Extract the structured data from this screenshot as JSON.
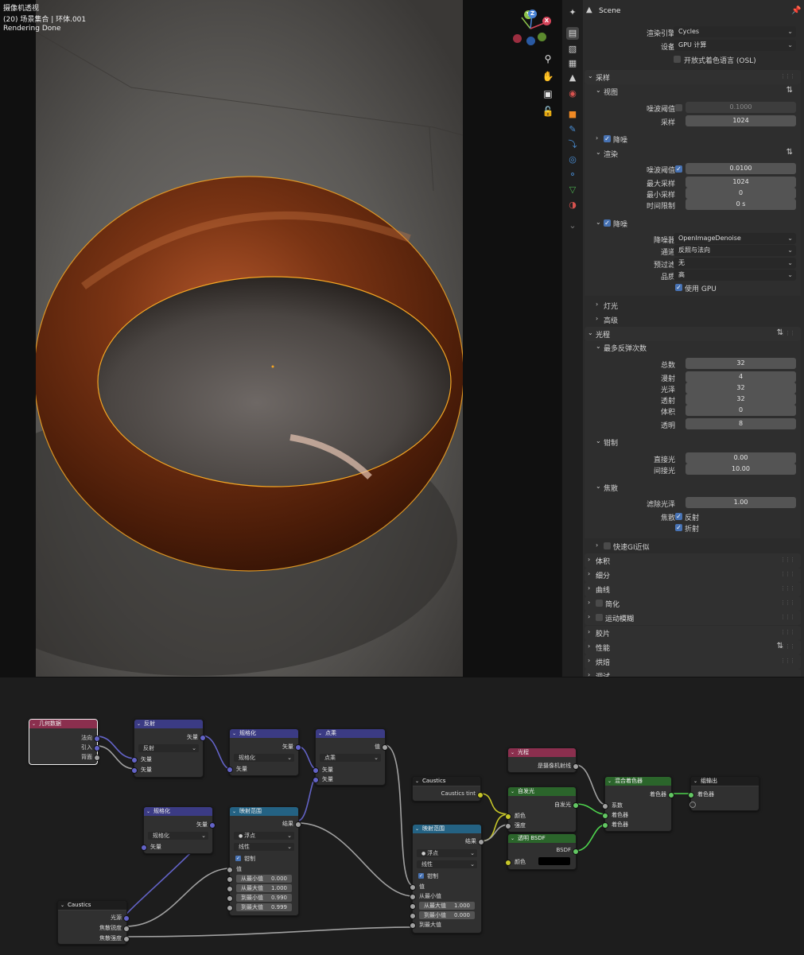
{
  "viewport": {
    "mode_label": "摄像机透视",
    "collection_label": "(20) 场景集合 | 环体.001",
    "status_label": "Rendering Done",
    "gizmo": {
      "y": "Y",
      "z": "Z",
      "x": "X"
    },
    "tools": {
      "zoom": "search-icon",
      "pan": "hand-icon",
      "camera": "camera-icon",
      "lock": "lock-icon"
    }
  },
  "props": {
    "header_title": "Scene",
    "render_engine_label": "渲染引擎",
    "render_engine_value": "Cycles",
    "device_label": "设备",
    "device_value": "GPU 计算",
    "osl_label": "开放式着色语言 (OSL)",
    "sampling": {
      "title": "采样",
      "viewport": {
        "title": "视图",
        "noise_threshold_label": "噪波阈值",
        "noise_threshold_value": "0.1000",
        "samples_label": "采样",
        "samples_value": "1024"
      },
      "viewport_denoise_title": "降噪",
      "render": {
        "title": "渲染",
        "noise_threshold_label": "噪波阈值",
        "noise_threshold_value": "0.0100",
        "max_samples_label": "最大采样",
        "max_samples_value": "1024",
        "min_samples_label": "最小采样",
        "min_samples_value": "0",
        "time_limit_label": "时间限制",
        "time_limit_value": "0 s"
      },
      "denoise": {
        "title": "降噪",
        "denoiser_label": "降噪器",
        "denoiser_value": "OpenImageDenoise",
        "passes_label": "通道",
        "passes_value": "反照与法向",
        "prefilter_label": "预过滤",
        "prefilter_value": "无",
        "quality_label": "品质",
        "quality_value": "高",
        "use_gpu_label": "使用 GPU"
      },
      "lights_title": "灯光",
      "advanced_title": "高级"
    },
    "light_paths": {
      "title": "光程",
      "max_bounces": {
        "title": "最多反弹次数",
        "rows": [
          {
            "label": "总数",
            "value": "32"
          },
          {
            "label": "漫射",
            "value": "4"
          },
          {
            "label": "光泽",
            "value": "32"
          },
          {
            "label": "透射",
            "value": "32"
          },
          {
            "label": "体积",
            "value": "0"
          },
          {
            "label": "透明",
            "value": "8"
          }
        ]
      },
      "clamping": {
        "title": "钳制",
        "direct_label": "直接光",
        "direct_value": "0.00",
        "indirect_label": "间接光",
        "indirect_value": "10.00"
      },
      "caustics": {
        "title": "焦散",
        "filter_glossy_label": "滤除光泽",
        "filter_glossy_value": "1.00",
        "caustics_label": "焦散",
        "reflective_label": "反射",
        "refractive_label": "折射"
      },
      "fast_gi_title": "快速GI近似"
    },
    "sections": [
      "体积",
      "细分",
      "曲线",
      "简化",
      "运动模糊",
      "胶片",
      "性能",
      "烘焙",
      "调试"
    ]
  },
  "nodes": {
    "geometry": {
      "title": "几何数据",
      "out1": "法向",
      "out2": "引入",
      "out3": "背面"
    },
    "reflect": {
      "title": "反射",
      "out": "矢量",
      "mode": "反射",
      "in1": "矢量",
      "in2": "矢量"
    },
    "normalize1": {
      "title": "规格化",
      "out": "矢量",
      "mode": "规格化",
      "in": "矢量"
    },
    "dot": {
      "title": "点乘",
      "out": "值",
      "mode": "点乘",
      "in1": "矢量",
      "in2": "矢量"
    },
    "caustics_tint": {
      "title": "Caustics",
      "out": "Caustics tint"
    },
    "lightpath": {
      "title": "光程",
      "out": "是摄像机射线"
    },
    "emission": {
      "title": "自发光",
      "out": "自发光",
      "in1": "颜色",
      "in2": "强度"
    },
    "mix": {
      "title": "混合着色器",
      "out": "着色器",
      "in1": "系数",
      "in2": "着色器",
      "in3": "着色器"
    },
    "output": {
      "title": "组输出",
      "in": "着色器"
    },
    "normalize2": {
      "title": "规格化",
      "out": "矢量",
      "mode": "规格化",
      "in": "矢量"
    },
    "maprange1": {
      "title": "映射范围",
      "out": "结果",
      "dtype": "浮点",
      "interp": "线性",
      "clamp": "钳制",
      "in_value": "值",
      "from_min_label": "从最小值",
      "from_min": "0.000",
      "from_max_label": "从最大值",
      "from_max": "1.000",
      "to_min_label": "到最小值",
      "to_min": "0.990",
      "to_max_label": "到最大值",
      "to_max": "0.999"
    },
    "transparent": {
      "title": "透明 BSDF",
      "out": "BSDF",
      "in": "颜色"
    },
    "maprange2": {
      "title": "映射范围",
      "out": "结果",
      "dtype": "浮点",
      "interp": "线性",
      "clamp": "钳制",
      "in_value": "值",
      "from_min_label": "从最小值",
      "from_max_label": "从最大值",
      "from_max": "1.000",
      "to_min_label": "到最小值",
      "to_min": "0.000",
      "to_max_label": "到最大值"
    },
    "caustics_in": {
      "title": "Caustics",
      "out1": "光源",
      "out2": "焦散锐度",
      "out3": "焦散强度"
    }
  },
  "colors": {
    "geometry_header": "#8b2f4e",
    "vector_header": "#3b3b84",
    "converter_header": "#246283",
    "shader_header": "#2b652b",
    "group_header": "#1d1d1d",
    "input_header": "#8b2f4e",
    "link_vector": "#6363c7",
    "link_value": "#a1a1a1",
    "link_color": "#c7c729",
    "link_shader": "#4dd24d",
    "selection": "#f5a623",
    "checkbox_on": "#4772b3"
  }
}
